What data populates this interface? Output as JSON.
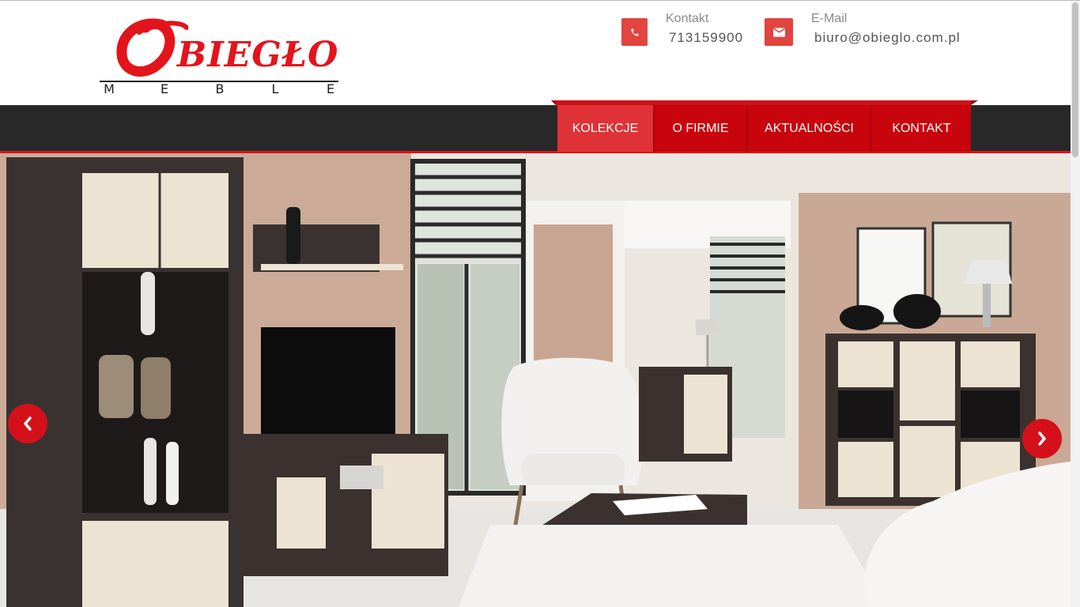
{
  "logo": {
    "text": "OBIEGŁO",
    "initial": "O",
    "rest": "BIEGŁO",
    "subtitle_letters": [
      "M",
      "E",
      "B",
      "L",
      "E"
    ],
    "color": "#e3141b"
  },
  "contacts": {
    "phone": {
      "label": "Kontakt",
      "value": "713159900",
      "icon": "phone-icon"
    },
    "email": {
      "label": "E-Mail",
      "value": "biuro@obieglo.com.pl",
      "icon": "envelope-icon"
    },
    "icon_color": "#e2443f"
  },
  "nav": {
    "items": [
      {
        "label": "KOLEKCJE",
        "active": true
      },
      {
        "label": "O FIRMIE",
        "active": false
      },
      {
        "label": "AKTUALNOŚCI",
        "active": false
      },
      {
        "label": "KONTAKT",
        "active": false
      }
    ],
    "bar_color": "#282828",
    "accent": "#c8040c"
  },
  "slider": {
    "image": "living-room-furniture-photo",
    "prev_icon": "chevron-left-icon",
    "next_icon": "chevron-right-icon"
  }
}
